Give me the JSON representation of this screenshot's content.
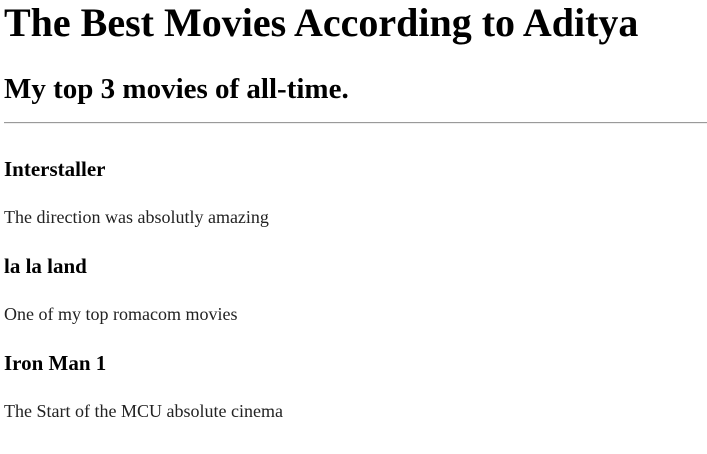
{
  "page": {
    "title": "The Best Movies According to Aditya",
    "subtitle": "My top 3 movies of all-time."
  },
  "movies": [
    {
      "title": "Interstaller",
      "description": "The direction was absolutly amazing"
    },
    {
      "title": "la la land",
      "description": "One of my top romacom movies"
    },
    {
      "title": "Iron Man 1",
      "description": "The Start of the MCU absolute cinema"
    }
  ]
}
